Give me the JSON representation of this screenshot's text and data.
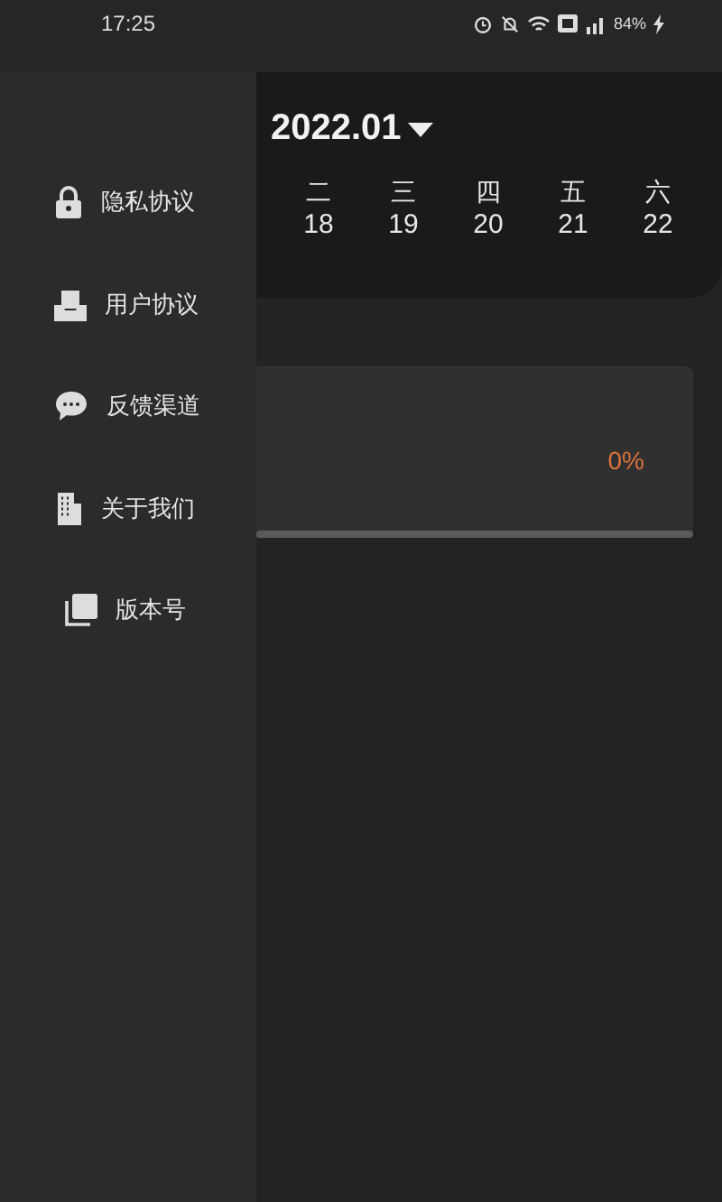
{
  "status_bar": {
    "time": "17:25",
    "battery": "84%"
  },
  "drawer": {
    "items": [
      {
        "label": "隐私协议"
      },
      {
        "label": "用户协议"
      },
      {
        "label": "反馈渠道"
      },
      {
        "label": "关于我们"
      },
      {
        "label": "版本号"
      }
    ]
  },
  "calendar": {
    "month": "2022.01",
    "days": [
      {
        "weekday": "二",
        "date": "18"
      },
      {
        "weekday": "三",
        "date": "19"
      },
      {
        "weekday": "四",
        "date": "20"
      },
      {
        "weekday": "五",
        "date": "21"
      },
      {
        "weekday": "六",
        "date": "22"
      }
    ]
  },
  "progress_card": {
    "percent": "0%",
    "level": 0
  }
}
